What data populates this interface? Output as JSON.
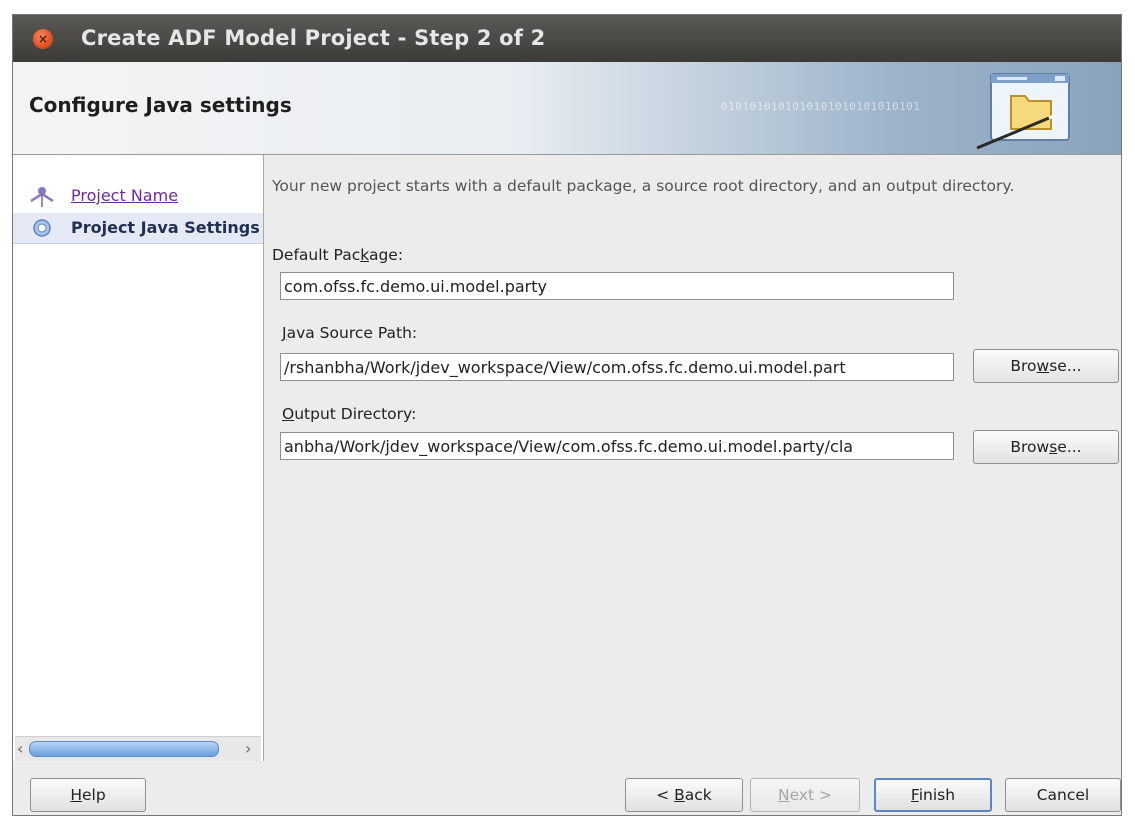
{
  "window": {
    "title": "Create ADF Model Project - Step 2 of 2",
    "close_icon": "×"
  },
  "header": {
    "title": "Configure Java settings",
    "decoration_text": "0101010101010101010101010101"
  },
  "steps": [
    {
      "label": "Project Name",
      "state": "completed"
    },
    {
      "label": "Project Java Settings",
      "state": "current"
    }
  ],
  "intro": "Your new project starts with a default package, a source root directory, and an output directory.",
  "fields": {
    "default_package": {
      "label_before": "Default Pac",
      "mnemonic": "k",
      "label_after": "age:",
      "value": "com.ofss.fc.demo.ui.model.party"
    },
    "java_source_path": {
      "label_before": "",
      "mnemonic": "J",
      "label_after": "ava Source Path:",
      "value": "/rshanbha/Work/jdev_workspace/View/com.ofss.fc.demo.ui.model.part",
      "browse": {
        "before": "Bro",
        "mnemonic": "w",
        "after": "se..."
      }
    },
    "output_directory": {
      "label_before": "",
      "mnemonic": "O",
      "label_after": "utput Directory:",
      "value": "anbha/Work/jdev_workspace/View/com.ofss.fc.demo.ui.model.party/cla",
      "browse": {
        "before": "Brow",
        "mnemonic": "s",
        "after": "e..."
      }
    }
  },
  "buttons": {
    "help": {
      "mnemonic": "H",
      "after": "elp"
    },
    "back": {
      "before": "< ",
      "mnemonic": "B",
      "after": "ack"
    },
    "next": {
      "before": "",
      "mnemonic": "N",
      "after": "ext >"
    },
    "finish": {
      "mnemonic": "F",
      "after": "inish"
    },
    "cancel": "Cancel"
  },
  "colors": {
    "accent": "#5a88c7",
    "link": "#6b2b9b",
    "current_step_bg": "#e4e9f5",
    "close": "#e0521f"
  },
  "icons": {
    "step_completed": "person-step-icon",
    "step_current": "current-step-icon",
    "header": "folder-icon"
  }
}
